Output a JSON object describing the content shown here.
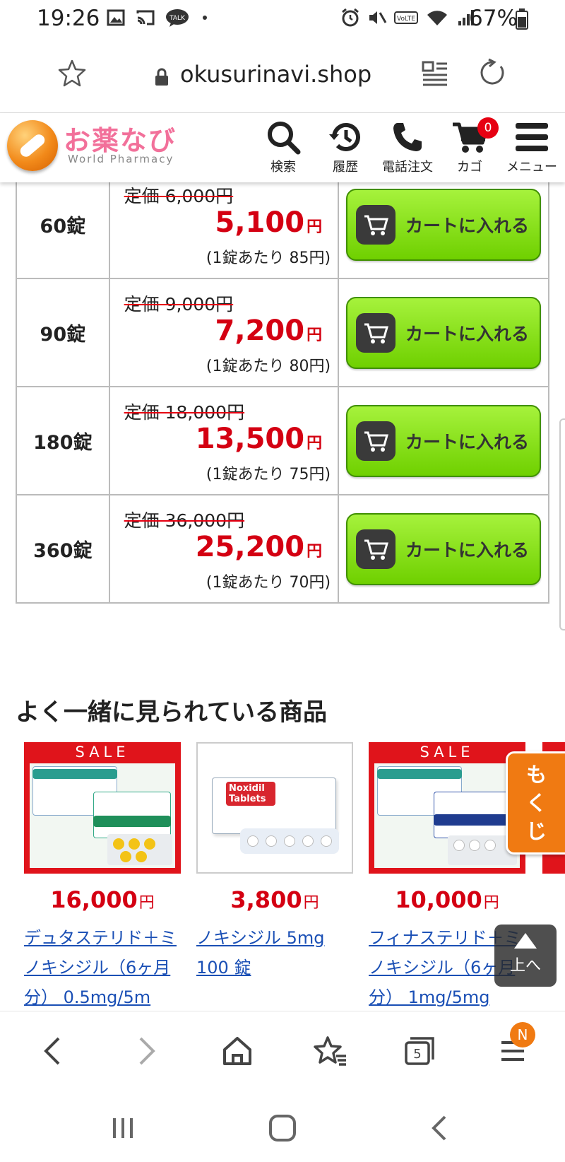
{
  "status_bar": {
    "time": "19:26",
    "talk_badge": "TALK",
    "volte": "VoLTE",
    "battery": "67%"
  },
  "url_bar": {
    "url": "okusurinavi.shop"
  },
  "site_header": {
    "logo_text": "お薬なび",
    "logo_subtext": "World Pharmacy",
    "nav": [
      {
        "label": "検索",
        "icon": "search-icon"
      },
      {
        "label": "履歴",
        "icon": "history-icon"
      },
      {
        "label": "電話注文",
        "icon": "phone-icon"
      },
      {
        "label": "カゴ",
        "icon": "cart-icon"
      },
      {
        "label": "メニュー",
        "icon": "menu-icon"
      }
    ],
    "cart_count": "0"
  },
  "price_table": {
    "rows": [
      {
        "qty": "60錠",
        "list_price": "定価 6,000円",
        "price": "5,100",
        "unit": "円",
        "per_tablet": "(1錠あたり 85円)",
        "button": "カートに入れる"
      },
      {
        "qty": "90錠",
        "list_price": "定価 9,000円",
        "price": "7,200",
        "unit": "円",
        "per_tablet": "(1錠あたり 80円)",
        "button": "カートに入れる"
      },
      {
        "qty": "180錠",
        "list_price": "定価 18,000円",
        "price": "13,500",
        "unit": "円",
        "per_tablet": "(1錠あたり 75円)",
        "button": "カートに入れる"
      },
      {
        "qty": "360錠",
        "list_price": "定価 36,000円",
        "price": "25,200",
        "unit": "円",
        "per_tablet": "(1錠あたり 70円)",
        "button": "カートに入れる"
      }
    ]
  },
  "related": {
    "title": "よく一緒に見られている商品",
    "products": [
      {
        "sale_tag": "SALE",
        "price": "16,000",
        "unit": "円",
        "name": "デュタステリド＋ミノキシジル（6ヶ月分） 0.5mg/5m"
      },
      {
        "sale_tag": "",
        "price": "3,800",
        "unit": "円",
        "name": "ノキシジル 5mg 100 錠",
        "box_text": "Noxidil Tablets"
      },
      {
        "sale_tag": "SALE",
        "price": "10,000",
        "unit": "円",
        "name": "フィナステリド＋ミノキシジル（6ヶ月分） 1mg/5mg"
      }
    ]
  },
  "floating": {
    "mokuji": "もくじ",
    "to_top": "上へ"
  },
  "browser_nav": {
    "tabs_count": "5",
    "notification_badge": "N"
  }
}
